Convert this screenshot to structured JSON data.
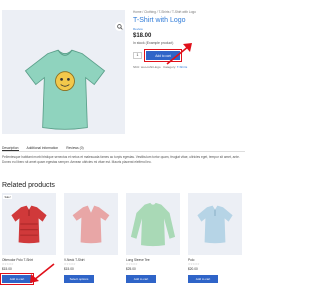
{
  "product": {
    "breadcrumb": "Home / Clothing / T-Shirts / T-Shirt with Logo",
    "title": "T-Shirt with Logo",
    "reviews": "Review",
    "price": "$18.00",
    "stock": "In stock (Example product)",
    "qty": "1",
    "add_to_cart": "Add to cart",
    "meta_sku_label": "SKU:",
    "meta_sku": "woo-tshirt-logo",
    "meta_cat_label": "Category:",
    "meta_cat": "T-Shirts"
  },
  "tabs": [
    "Description",
    "Additional information",
    "Reviews (0)"
  ],
  "description": "Pellentesque habitant morbi tristique senectus et netus et malesuada fames ac turpis egestas. Vestibulum tortor quam, feugiat vitae, ultricies eget, tempor sit amet, ante. Donec eu libero sit amet quam egestas semper. Aenean ultricies mi vitae est. Mauris placerat eleifend leo.",
  "related": {
    "heading": "Related products",
    "items": [
      {
        "name": "Otterodor Polo T-Shirt",
        "rating": "☆☆☆☆☆",
        "price": "$15.00",
        "button": "Add to cart",
        "color": "#d0393a",
        "sale": "Sale!"
      },
      {
        "name": "V-Neck T-Shirt",
        "rating": "☆☆☆☆☆",
        "price": "$15.00",
        "button": "Select options",
        "color": "#e8a6a6",
        "sale": ""
      },
      {
        "name": "Long Sleeve Tee",
        "rating": "☆☆☆☆☆",
        "price": "$25.00",
        "button": "Add to cart",
        "color": "#a9d9b6",
        "sale": ""
      },
      {
        "name": "Polo",
        "rating": "☆☆☆☆☆",
        "price": "$20.00",
        "button": "Add to cart",
        "color": "#b6d4e6",
        "sale": ""
      }
    ]
  },
  "colors": {
    "accent": "#2f64c8",
    "link": "#2f7bd8",
    "highlight": "#e0101a",
    "tee_main": "#8fd3be"
  }
}
